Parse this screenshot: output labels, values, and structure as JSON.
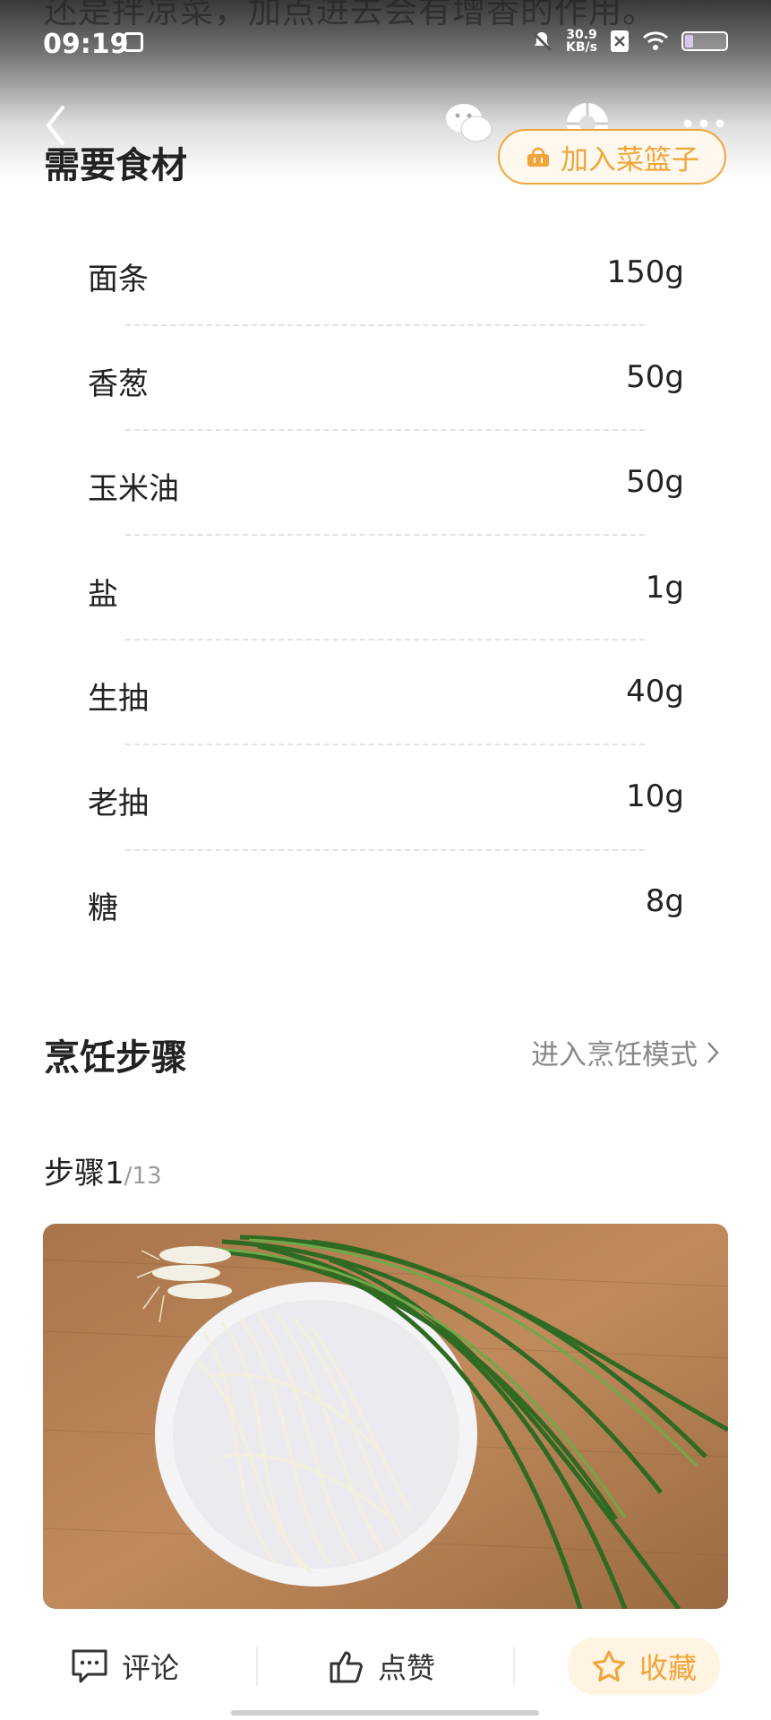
{
  "prior_text": "还是拌凉菜，加点进去会有增香的作用。",
  "status": {
    "time": "09:19",
    "net_speed_top": "30.9",
    "net_speed_unit": "KB/s",
    "battery_level": 0.2
  },
  "ingredients": {
    "title": "需要食材",
    "basket_label": "加入菜篮子",
    "items": [
      {
        "name": "面条",
        "amount": "150g"
      },
      {
        "name": "香葱",
        "amount": "50g"
      },
      {
        "name": "玉米油",
        "amount": "50g"
      },
      {
        "name": "盐",
        "amount": "1g"
      },
      {
        "name": "生抽",
        "amount": "40g"
      },
      {
        "name": "老抽",
        "amount": "10g"
      },
      {
        "name": "糖",
        "amount": "8g"
      }
    ]
  },
  "steps": {
    "title": "烹饪步骤",
    "cook_mode_label": "进入烹饪模式",
    "step_prefix": "步骤1",
    "step_total": "/13"
  },
  "bottom_bar": {
    "comment": "评论",
    "like": "点赞",
    "favorite": "收藏"
  },
  "colors": {
    "accent": "#f0a53a"
  }
}
